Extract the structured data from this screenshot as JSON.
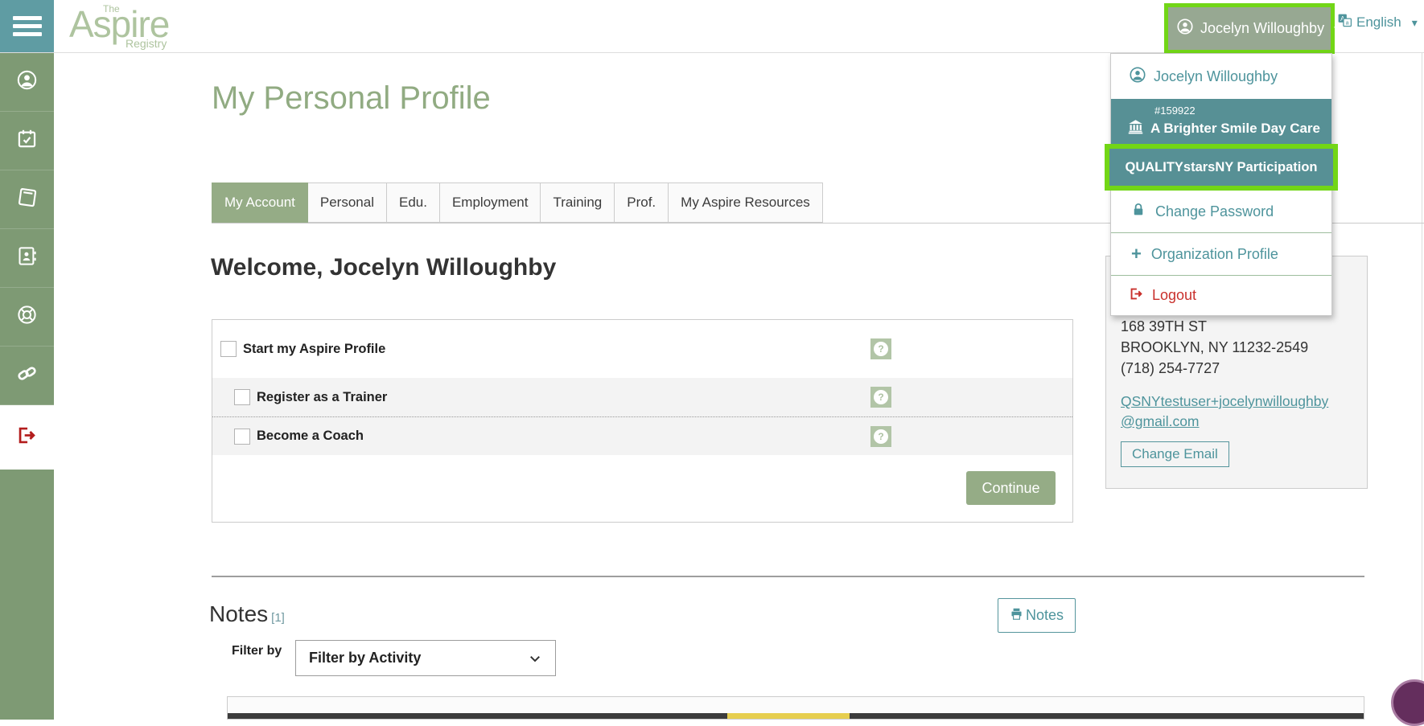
{
  "header": {
    "logo": {
      "line_the": "The",
      "line_main": "Aspire",
      "line_sub": "Registry"
    },
    "user_button_label": "Jocelyn Willoughby",
    "caret": "▾",
    "language_label": "English"
  },
  "page": {
    "title": "My Personal Profile"
  },
  "tabs": [
    {
      "label": "My Account",
      "active": true
    },
    {
      "label": "Personal"
    },
    {
      "label": "Edu."
    },
    {
      "label": "Employment"
    },
    {
      "label": "Training"
    },
    {
      "label": "Prof."
    },
    {
      "label": "My Aspire Resources"
    }
  ],
  "account": {
    "welcome_heading": "Welcome, Jocelyn Willoughby",
    "options": [
      {
        "label": "Start my Aspire Profile",
        "checked": false
      },
      {
        "label": "Register as a Trainer",
        "checked": false
      },
      {
        "label": "Become a Coach",
        "checked": false
      }
    ],
    "help_glyph": "?",
    "continue_label": "Continue"
  },
  "user_menu": {
    "profile_name": "Jocelyn Willoughby",
    "org_number": "#159922",
    "org_name": "A Brighter Smile Day Care",
    "participation_label": "QUALITYstarsNY Participation",
    "change_password_label": "Change Password",
    "organization_profile_label": "Organization Profile",
    "logout_label": "Logout"
  },
  "contact_panel": {
    "address_line1": "168 39TH ST",
    "address_line2": "BROOKLYN, NY 11232-2549",
    "phone": "(718) 254-7727",
    "email_line1": "QSNYtestuser+jocelynwilloughby",
    "email_line2": "@gmail.com",
    "change_email_label": "Change Email"
  },
  "notes": {
    "heading": "Notes",
    "count": "[1]",
    "print_button_label": "Notes",
    "filter_label": "Filter by",
    "filter_selected": "Filter by Activity"
  },
  "colors": {
    "header_teal": "#5f9ca3",
    "sidebar_green": "#7e9a74",
    "accent_sage": "#95ac86",
    "teal_text": "#4e949c",
    "menu_teal_bg": "#579095",
    "annotation_green": "#72d616",
    "logout_red": "#c9302c",
    "note_bar_dark": "#3c3c3c",
    "note_bar_yellow": "#e6ce4f",
    "widget_purple": "#642e5d"
  }
}
